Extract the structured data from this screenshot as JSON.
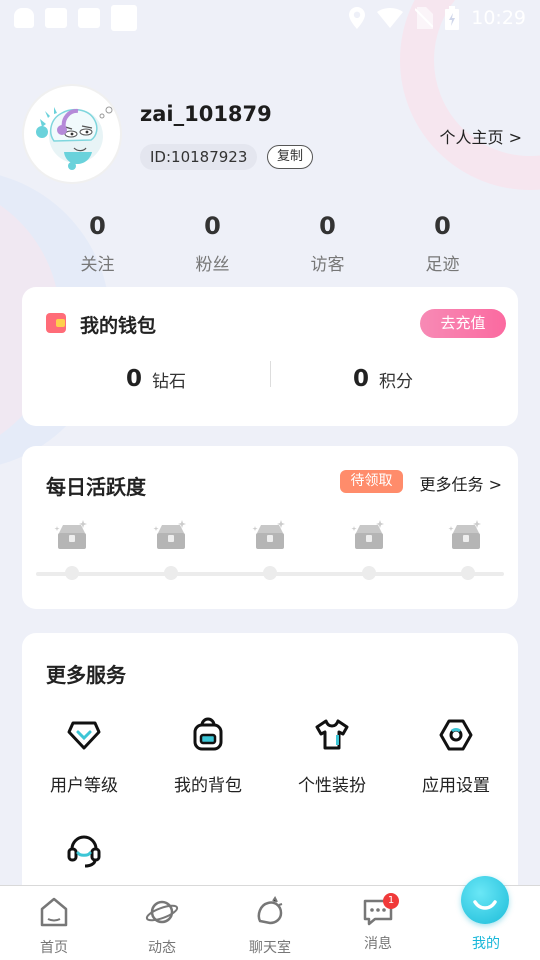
{
  "status_bar": {
    "time": "10:29"
  },
  "profile": {
    "username": "zai_101879",
    "user_id": "ID:10187923",
    "copy_label": "复制",
    "homepage_link": "个人主页 >"
  },
  "stats": [
    {
      "value": "0",
      "label": "关注"
    },
    {
      "value": "0",
      "label": "粉丝"
    },
    {
      "value": "0",
      "label": "访客"
    },
    {
      "value": "0",
      "label": "足迹"
    }
  ],
  "wallet": {
    "title": "我的钱包",
    "recharge_label": "去充值",
    "diamonds": {
      "value": "0",
      "label": "钻石"
    },
    "points": {
      "value": "0",
      "label": "积分"
    }
  },
  "daily": {
    "title": "每日活跃度",
    "pending_label": "待领取",
    "more_tasks": "更多任务 >",
    "chest_count_note": "chest-icon"
  },
  "services": {
    "title": "更多服务",
    "items": [
      {
        "label": "用户等级",
        "icon": "diamond-icon"
      },
      {
        "label": "我的背包",
        "icon": "backpack-icon"
      },
      {
        "label": "个性装扮",
        "icon": "shirt-icon"
      },
      {
        "label": "应用设置",
        "icon": "settings-icon"
      },
      {
        "label": "",
        "icon": "customer-service-icon"
      }
    ]
  },
  "tabbar": {
    "tabs": [
      {
        "label": "首页",
        "icon": "home-icon"
      },
      {
        "label": "动态",
        "icon": "planet-icon"
      },
      {
        "label": "聊天室",
        "icon": "chatroom-icon"
      },
      {
        "label": "消息",
        "icon": "message-icon",
        "badge": "1"
      },
      {
        "label": "我的",
        "icon": "profile-icon"
      }
    ]
  },
  "colors": {
    "accent": "#18b7d9",
    "recharge": "#fb6aa0",
    "pending": "#ff8c6b",
    "badge": "#f03a3a"
  }
}
